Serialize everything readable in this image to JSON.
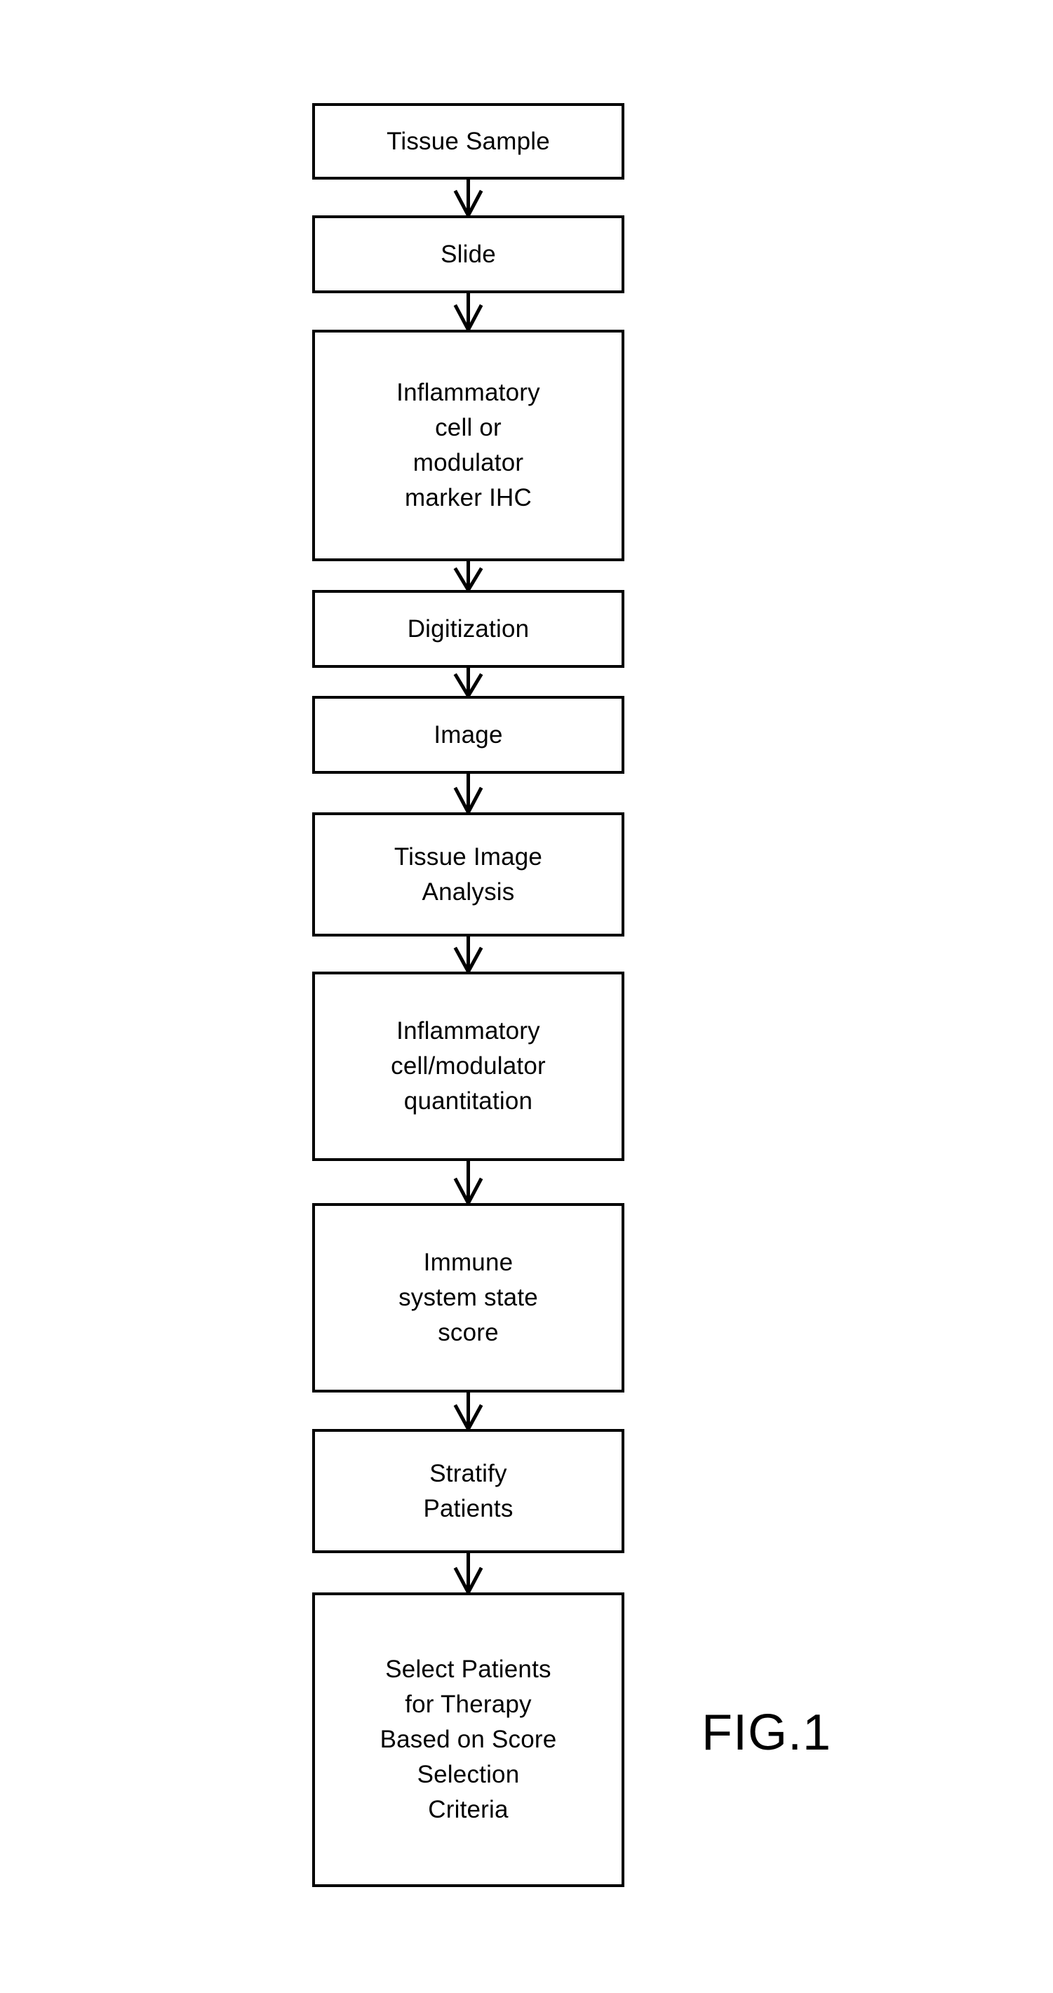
{
  "figure": {
    "caption": "FIG.1",
    "ink_color": "#000000",
    "background_color": "#ffffff"
  },
  "flowchart": {
    "orientation": "top-to-bottom",
    "connector_style": "single-headed-open-v-arrow",
    "nodes": [
      {
        "id": "tissue-sample",
        "label": "Tissue Sample"
      },
      {
        "id": "slide",
        "label": "Slide"
      },
      {
        "id": "marker-ihc",
        "label": "Inflammatory\ncell or\nmodulator\nmarker IHC"
      },
      {
        "id": "digitization",
        "label": "Digitization"
      },
      {
        "id": "image",
        "label": "Image"
      },
      {
        "id": "tissue-image-analysis",
        "label": "Tissue Image\nAnalysis"
      },
      {
        "id": "quantitation",
        "label": "Inflammatory\ncell/modulator\nquantitation"
      },
      {
        "id": "immune-score",
        "label": "Immune\nsystem state\nscore"
      },
      {
        "id": "stratify-patients",
        "label": "Stratify\nPatients"
      },
      {
        "id": "select-patients",
        "label": "Select Patients\nfor Therapy\nBased on Score\nSelection\nCriteria"
      }
    ],
    "edges": [
      {
        "from": "tissue-sample",
        "to": "slide"
      },
      {
        "from": "slide",
        "to": "marker-ihc"
      },
      {
        "from": "marker-ihc",
        "to": "digitization"
      },
      {
        "from": "digitization",
        "to": "image"
      },
      {
        "from": "image",
        "to": "tissue-image-analysis"
      },
      {
        "from": "tissue-image-analysis",
        "to": "quantitation"
      },
      {
        "from": "quantitation",
        "to": "immune-score"
      },
      {
        "from": "immune-score",
        "to": "stratify-patients"
      },
      {
        "from": "stratify-patients",
        "to": "select-patients"
      }
    ]
  }
}
